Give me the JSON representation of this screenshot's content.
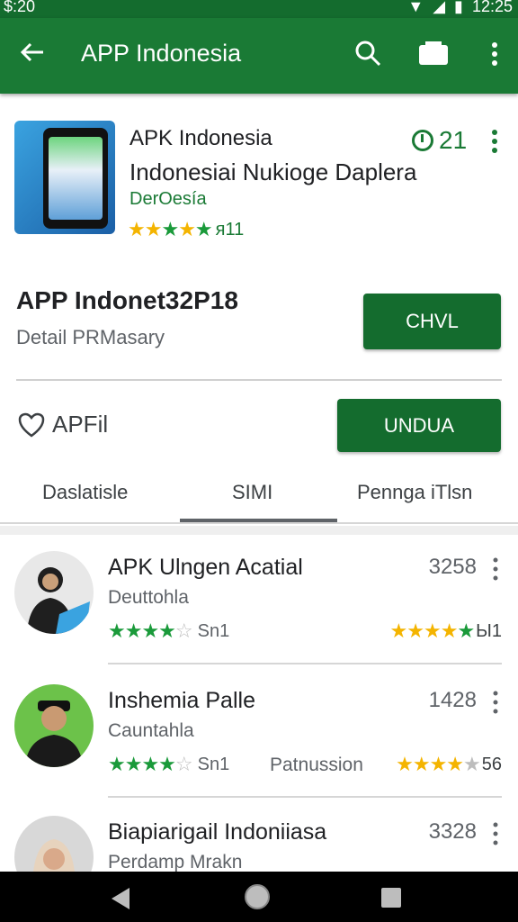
{
  "status": {
    "time_left": "$:20",
    "time_right": "12:25"
  },
  "appbar": {
    "title": "APP Indonesia"
  },
  "app": {
    "name": "APK Indonesia",
    "subtitle": "Indonesiai Nukioge Daplera",
    "developer": "DerOesía",
    "rating_text": "я11",
    "count": "21"
  },
  "detail": {
    "title": "APP Indonet32P18",
    "subtitle": "Detail PRMasary",
    "button": "CHVL"
  },
  "favorite": {
    "label": "APFil",
    "button": "UNDUA"
  },
  "tabs": [
    {
      "label": "Daslatisle"
    },
    {
      "label": "SIMI"
    },
    {
      "label": "Pennga iTlsn"
    }
  ],
  "reviews": [
    {
      "name": "APK Ulngen Acatial",
      "sub": "Deuttohla",
      "count": "3258",
      "left_text": "Sn1",
      "mid_text": "",
      "right_text": "Ы1"
    },
    {
      "name": "Inshemia Palle",
      "sub": "Cauntahla",
      "count": "1428",
      "left_text": "Sn1",
      "mid_text": "Patnussion",
      "right_text": "56"
    },
    {
      "name": "Biapiarigail Indoniiasa",
      "sub": "Perdamp Mrakn",
      "count": "3328",
      "left_text": "",
      "mid_text": "",
      "right_text": ""
    }
  ],
  "colors": {
    "primary": "#1a7a35",
    "primary_dark": "#146c2e",
    "star_yellow": "#f4b400",
    "star_green": "#1a9a3a"
  },
  "icons": [
    "back-arrow-icon",
    "search-icon",
    "cast-icon",
    "more-vert-icon",
    "clock-icon",
    "heart-icon",
    "nav-back-icon",
    "nav-home-icon",
    "nav-recent-icon"
  ]
}
